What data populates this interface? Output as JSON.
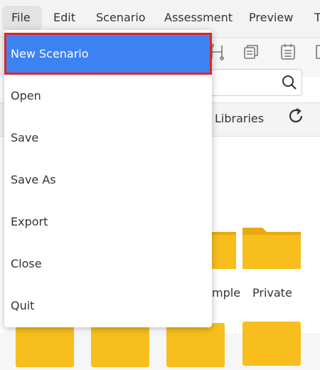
{
  "menubar": {
    "items": [
      {
        "label": "File"
      },
      {
        "label": "Edit"
      },
      {
        "label": "Scenario"
      },
      {
        "label": "Assessment"
      },
      {
        "label": "Preview"
      },
      {
        "label": "T"
      }
    ]
  },
  "file_menu": {
    "items": [
      {
        "label": "New Scenario"
      },
      {
        "label": "Open"
      },
      {
        "label": "Save"
      },
      {
        "label": "Save As"
      },
      {
        "label": "Export"
      },
      {
        "label": "Close"
      },
      {
        "label": "Quit"
      }
    ]
  },
  "libraries_panel": {
    "title": "Libraries",
    "folders": [
      {
        "label": "mple"
      },
      {
        "label": "Private"
      }
    ]
  },
  "colors": {
    "highlight": "#3d82f2",
    "selection_outline": "#e02424",
    "folder": "#f5b40f"
  },
  "icons": [
    "path-icon",
    "copy-icon",
    "list-icon",
    "search-icon",
    "refresh-icon",
    "folder-icon"
  ]
}
